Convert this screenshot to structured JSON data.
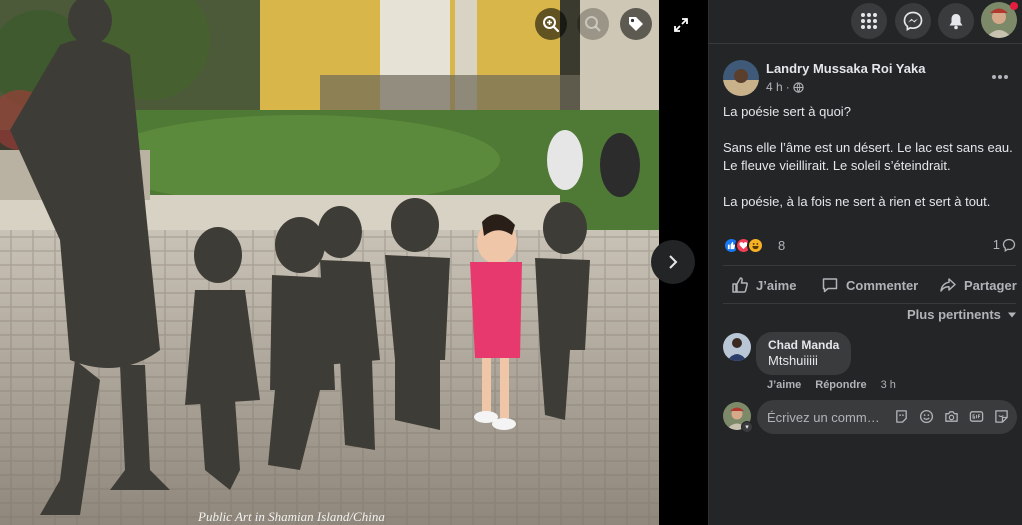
{
  "viewer": {
    "caption": "Public Art in Shamian Island/China",
    "zoom_in_icon": "zoom-in-icon",
    "tag_icon": "tag-icon",
    "expand_icon": "expand-icon",
    "next_icon": "chevron-right-icon"
  },
  "topbar": {
    "menu_icon": "grid-menu-icon",
    "messenger_icon": "messenger-icon",
    "notifications_icon": "bell-icon",
    "notification_dot_color": "#e41e3f"
  },
  "post": {
    "author": "Landry Mussaka Roi Yaka",
    "time": "4 h",
    "separator": "·",
    "audience_icon": "globe-icon",
    "paragraphs": [
      "La poésie sert à quoi?",
      "Sans elle l’âme est un désert. Le lac est sans eau. Le fleuve vieillirait. Le soleil s’éteindrait.",
      "La poésie, à la fois ne sert à rien et sert à tout."
    ],
    "reactions": {
      "types": [
        "like",
        "love",
        "haha"
      ],
      "count": "8",
      "comments": "1"
    },
    "actions": {
      "like": "J’aime",
      "comment": "Commenter",
      "share": "Partager"
    },
    "sort_label": "Plus pertinents"
  },
  "comments": [
    {
      "author": "Chad Manda",
      "text": "Mtshuiiiii",
      "like": "J’aime",
      "reply": "Répondre",
      "time": "3 h"
    }
  ],
  "composer": {
    "placeholder": "Écrivez un comm…",
    "tools": [
      "avatar-sticker-icon",
      "emoji-icon",
      "camera-icon",
      "gif-icon",
      "sticker-icon"
    ]
  },
  "colors": {
    "panel_bg": "#242526",
    "bubble_bg": "#3a3b3c",
    "text": "#e4e6eb",
    "secondary_text": "#b0b3b8",
    "like_blue": "#1877f2",
    "love_red": "#f33e58",
    "haha_yellow": "#f7b125"
  }
}
